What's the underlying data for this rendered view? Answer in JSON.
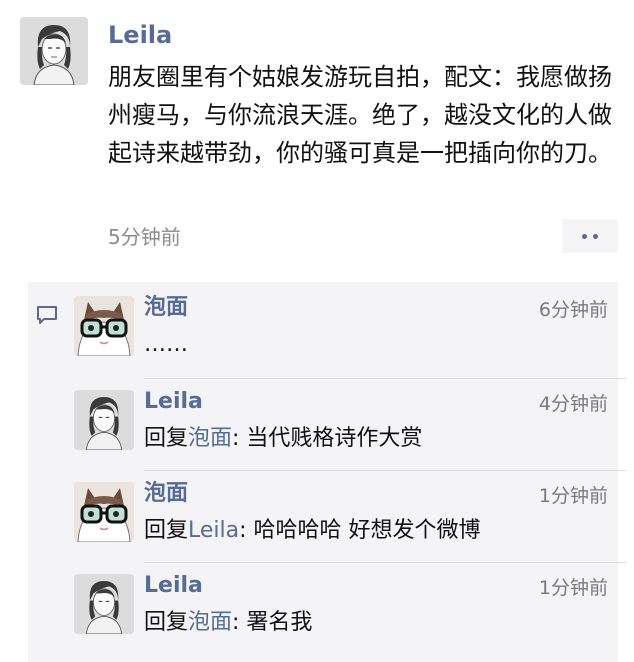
{
  "post": {
    "author": "Leila",
    "text": "朋友圈里有个姑娘发游玩自拍，配文：我愿做扬州瘦马，与你流浪天涯。绝了，越没文化的人做起诗来越带劲，你的骚可真是一把插向你的刀。",
    "time": "5分钟前",
    "more_icon": "more-dots-icon"
  },
  "comments": [
    {
      "author": "泡面",
      "time": "6分钟前",
      "text": "……",
      "avatar": "cat-glasses-avatar"
    },
    {
      "author": "Leila",
      "time": "4分钟前",
      "reply_prefix": "回复",
      "reply_to": "泡面",
      "text": ": 当代贱格诗作大赏",
      "avatar": "woman-sketch-avatar"
    },
    {
      "author": "泡面",
      "time": "1分钟前",
      "reply_prefix": "回复",
      "reply_to": "Leila",
      "text": ": 哈哈哈哈 好想发个微博",
      "avatar": "cat-glasses-avatar"
    },
    {
      "author": "Leila",
      "time": "1分钟前",
      "reply_prefix": "回复",
      "reply_to": "泡面",
      "text": ": 署名我",
      "avatar": "woman-sketch-avatar"
    }
  ],
  "colors": {
    "name_link": "#576b95",
    "panel_bg": "#f4f4f6",
    "time_text": "#8c8c8c"
  }
}
